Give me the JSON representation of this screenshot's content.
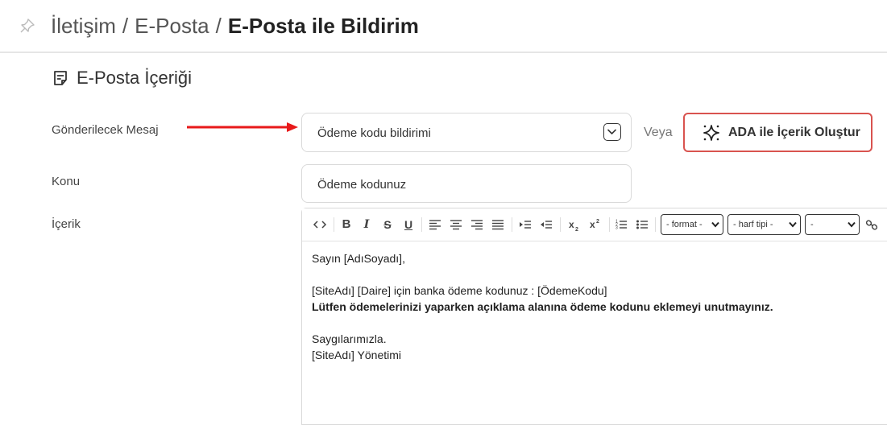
{
  "breadcrumb": {
    "items": [
      "İletişim",
      "E-Posta"
    ],
    "separator": "/",
    "current": "E-Posta ile Bildirim"
  },
  "section": {
    "title": "E-Posta İçeriği"
  },
  "form": {
    "message_label": "Gönderilecek Mesaj",
    "message_value": "Ödeme kodu bildirimi",
    "or_text": "Veya",
    "ada_button_label": "ADA ile İçerik Oluştur",
    "subject_label": "Konu",
    "subject_value": "Ödeme kodunuz",
    "content_label": "İçerik"
  },
  "toolbar": {
    "bold": "B",
    "italic": "I",
    "strike": "S",
    "underline": "U",
    "format_select": "- format -",
    "font_select": "- harf tipi -",
    "size_select": "-"
  },
  "editor": {
    "lines": [
      "Sayın [AdıSoyadı],",
      "",
      "[SiteAdı] [Daire] için banka ödeme kodunuz : [ÖdemeKodu]",
      "Lütfen ödemelerinizi yaparken açıklama alanına ödeme kodunu eklemeyi unutmayınız.",
      "",
      "Saygılarımızla.",
      "[SiteAdı] Yönetimi"
    ]
  },
  "colors": {
    "accent_border": "#d9534f",
    "annotation_arrow": "#e8191a"
  },
  "icons": [
    "pin-icon",
    "document-icon",
    "sparkle-icon",
    "chevron-down-icon",
    "link-icon"
  ]
}
